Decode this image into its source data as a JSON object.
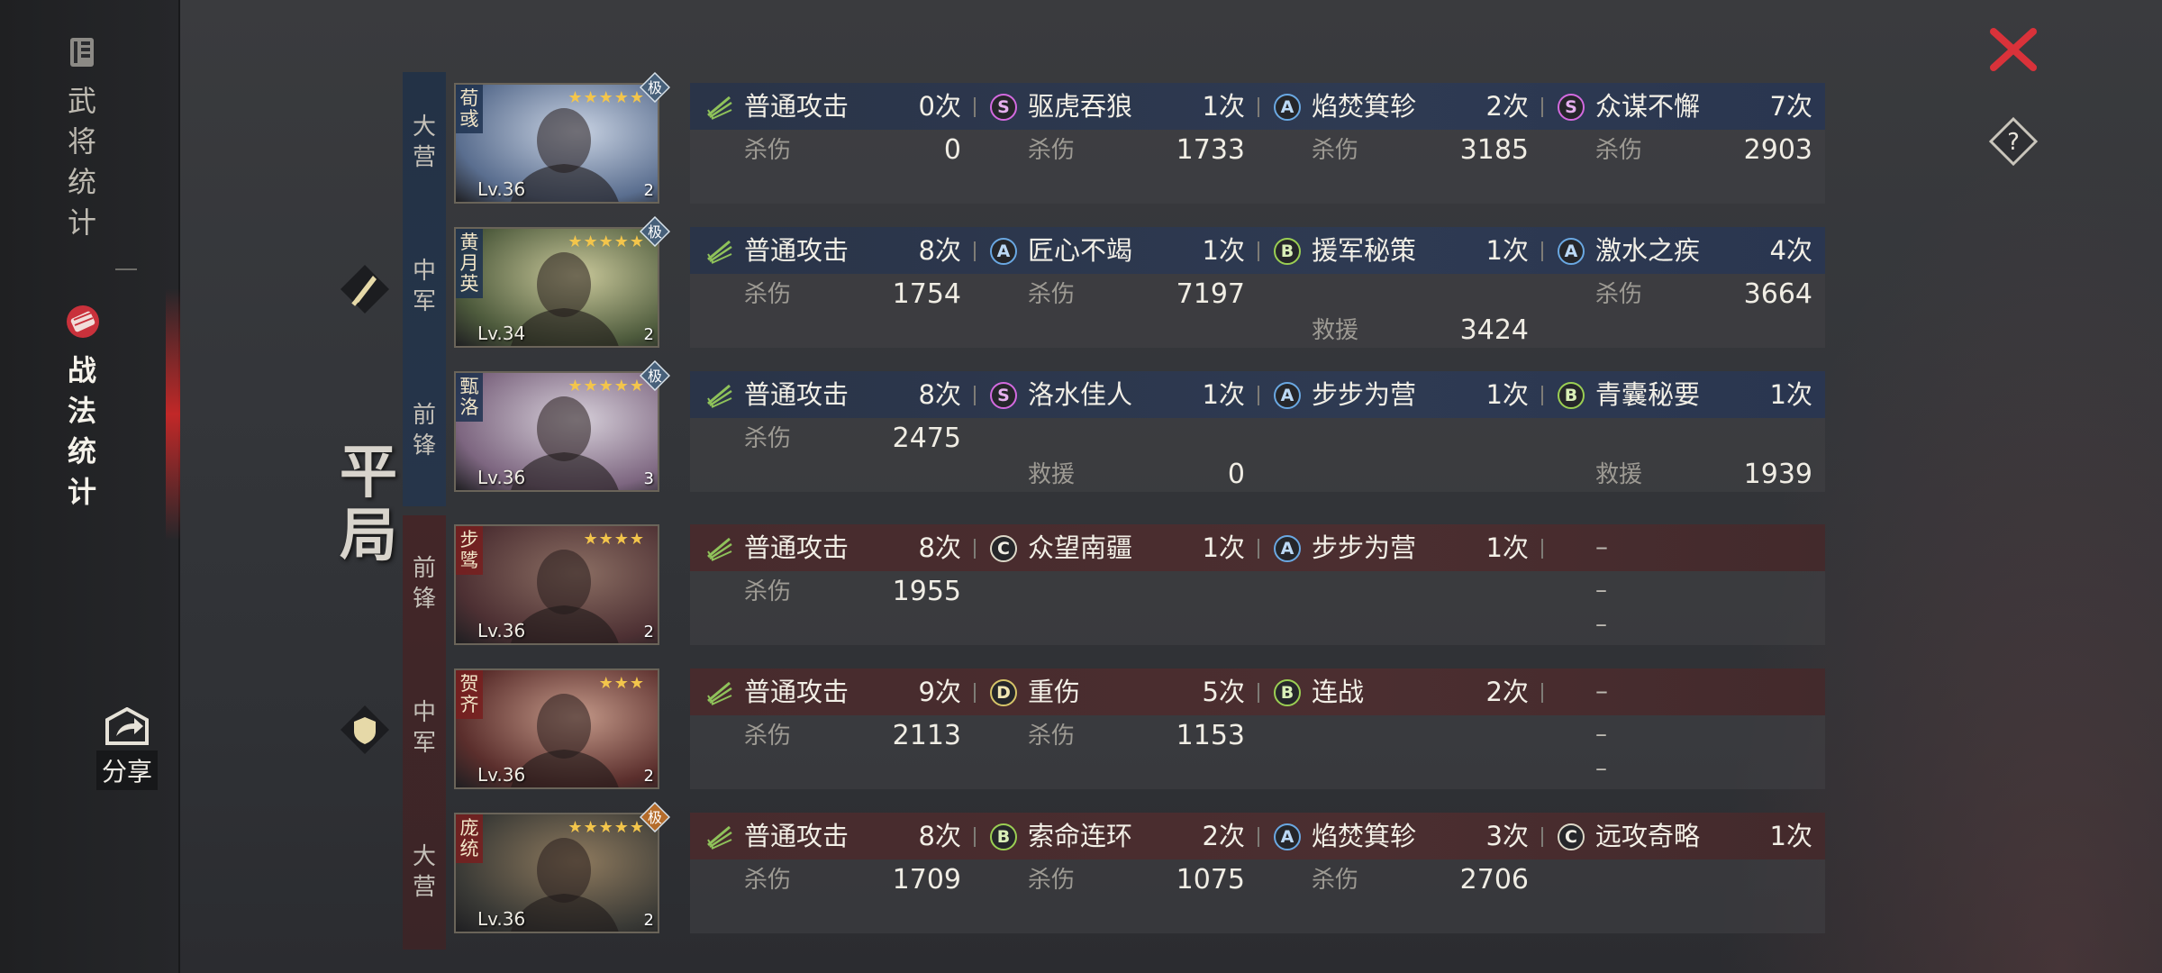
{
  "sidebar": {
    "items": [
      {
        "label": "武\n将\n统\n计",
        "chars": [
          "武",
          "将",
          "统",
          "计"
        ],
        "icon": "book-icon",
        "active": false
      },
      {
        "label": "战\n法\n统\n计",
        "chars": [
          "战",
          "法",
          "统",
          "计"
        ],
        "icon": "scroll-seal-icon",
        "active": true
      }
    ],
    "share_label": "分享",
    "share_icon": "share-icon"
  },
  "controls": {
    "close_icon": "close-icon",
    "help_icon": "help-icon"
  },
  "result": {
    "chars": [
      "平",
      "局"
    ]
  },
  "teams": [
    {
      "side": "blue",
      "icon": "sword-icon",
      "generals": [
        {
          "position": [
            "大",
            "营"
          ],
          "name_chars": [
            "荀",
            "彧"
          ],
          "stars": "★★★★★",
          "level": "Lv.36",
          "rank": "2",
          "badge": "极",
          "skills": [
            {
              "grade": "",
              "icon": "normal-attack-icon",
              "name": "普通攻击",
              "count": "0次",
              "rows": [
                {
                  "label": "杀伤",
                  "value": "0"
                }
              ]
            },
            {
              "grade": "S",
              "name": "驱虎吞狼",
              "count": "1次",
              "rows": [
                {
                  "label": "杀伤",
                  "value": "1733"
                }
              ]
            },
            {
              "grade": "A",
              "name": "焰焚箕轸",
              "count": "2次",
              "rows": [
                {
                  "label": "杀伤",
                  "value": "3185"
                }
              ]
            },
            {
              "grade": "S",
              "name": "众谋不懈",
              "count": "7次",
              "rows": [
                {
                  "label": "杀伤",
                  "value": "2903"
                }
              ]
            }
          ]
        },
        {
          "position": [
            "中",
            "军"
          ],
          "name_chars": [
            "黄",
            "月",
            "英"
          ],
          "stars": "★★★★★",
          "level": "Lv.34",
          "rank": "2",
          "badge": "极",
          "skills": [
            {
              "grade": "",
              "icon": "normal-attack-icon",
              "name": "普通攻击",
              "count": "8次",
              "rows": [
                {
                  "label": "杀伤",
                  "value": "1754"
                }
              ]
            },
            {
              "grade": "A",
              "name": "匠心不竭",
              "count": "1次",
              "rows": [
                {
                  "label": "杀伤",
                  "value": "7197"
                }
              ]
            },
            {
              "grade": "B",
              "name": "援军秘策",
              "count": "1次",
              "rows": [
                {
                  "label": "",
                  "value": ""
                },
                {
                  "label": "救援",
                  "value": "3424"
                }
              ]
            },
            {
              "grade": "A",
              "name": "激水之疾",
              "count": "4次",
              "rows": [
                {
                  "label": "杀伤",
                  "value": "3664"
                }
              ]
            }
          ]
        },
        {
          "position": [
            "前",
            "锋"
          ],
          "name_chars": [
            "甄",
            "洛"
          ],
          "stars": "★★★★★",
          "level": "Lv.36",
          "rank": "3",
          "badge": "极",
          "skills": [
            {
              "grade": "",
              "icon": "normal-attack-icon",
              "name": "普通攻击",
              "count": "8次",
              "rows": [
                {
                  "label": "杀伤",
                  "value": "2475"
                }
              ]
            },
            {
              "grade": "S",
              "name": "洛水佳人",
              "count": "1次",
              "rows": [
                {
                  "label": "",
                  "value": ""
                },
                {
                  "label": "救援",
                  "value": "0"
                }
              ]
            },
            {
              "grade": "A",
              "name": "步步为营",
              "count": "1次",
              "rows": []
            },
            {
              "grade": "B",
              "name": "青囊秘要",
              "count": "1次",
              "rows": [
                {
                  "label": "",
                  "value": ""
                },
                {
                  "label": "救援",
                  "value": "1939"
                }
              ]
            }
          ]
        }
      ]
    },
    {
      "side": "red",
      "icon": "shield-icon",
      "generals": [
        {
          "position": [
            "前",
            "锋"
          ],
          "name_chars": [
            "步",
            "骘"
          ],
          "stars": "★★★★",
          "level": "Lv.36",
          "rank": "2",
          "badge": "",
          "skills": [
            {
              "grade": "",
              "icon": "normal-attack-icon",
              "name": "普通攻击",
              "count": "8次",
              "rows": [
                {
                  "label": "杀伤",
                  "value": "1955"
                }
              ]
            },
            {
              "grade": "C",
              "name": "众望南疆",
              "count": "1次",
              "rows": []
            },
            {
              "grade": "A",
              "name": "步步为营",
              "count": "1次",
              "rows": []
            },
            {
              "grade": "",
              "name": "",
              "count": "",
              "empty": true,
              "dash": "–",
              "rows": []
            }
          ]
        },
        {
          "position": [
            "中",
            "军"
          ],
          "name_chars": [
            "贺",
            "齐"
          ],
          "stars": "★★★",
          "level": "Lv.36",
          "rank": "2",
          "badge": "",
          "skills": [
            {
              "grade": "",
              "icon": "normal-attack-icon",
              "name": "普通攻击",
              "count": "9次",
              "rows": [
                {
                  "label": "杀伤",
                  "value": "2113"
                }
              ]
            },
            {
              "grade": "D",
              "name": "重伤",
              "count": "5次",
              "rows": [
                {
                  "label": "杀伤",
                  "value": "1153"
                }
              ]
            },
            {
              "grade": "B",
              "name": "连战",
              "count": "2次",
              "rows": []
            },
            {
              "grade": "",
              "name": "",
              "count": "",
              "empty": true,
              "dash": "–",
              "rows": []
            }
          ]
        },
        {
          "position": [
            "大",
            "营"
          ],
          "name_chars": [
            "庞",
            "统"
          ],
          "stars": "★★★★★",
          "level": "Lv.36",
          "rank": "2",
          "badge": "极",
          "skills": [
            {
              "grade": "",
              "icon": "normal-attack-icon",
              "name": "普通攻击",
              "count": "8次",
              "rows": [
                {
                  "label": "杀伤",
                  "value": "1709"
                }
              ]
            },
            {
              "grade": "B",
              "name": "索命连环",
              "count": "2次",
              "rows": [
                {
                  "label": "杀伤",
                  "value": "1075"
                }
              ]
            },
            {
              "grade": "A",
              "name": "焰焚箕轸",
              "count": "3次",
              "rows": [
                {
                  "label": "杀伤",
                  "value": "2706"
                }
              ]
            },
            {
              "grade": "C",
              "name": "远攻奇略",
              "count": "1次",
              "rows": []
            }
          ]
        }
      ]
    }
  ],
  "colors": {
    "blue_band": "#26354a",
    "red_band": "#432628",
    "close": "#d9323a",
    "stars": "#f3c54b"
  }
}
